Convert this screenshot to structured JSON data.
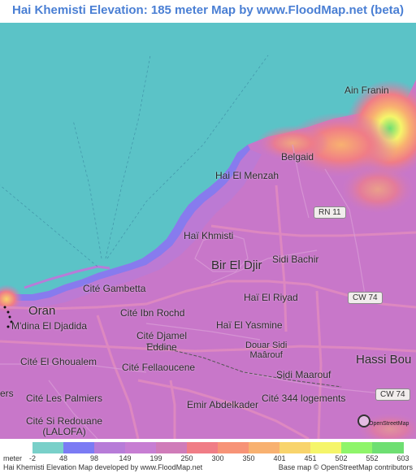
{
  "title": "Hai Khemisti Elevation: 185 meter Map by www.FloodMap.net (beta)",
  "places": [
    {
      "id": "ain-franin",
      "label": "Ain Franin"
    },
    {
      "id": "belgaid",
      "label": "Belgaid"
    },
    {
      "id": "hai-el-menzah",
      "label": "Hai El Menzah"
    },
    {
      "id": "hai-khmisti",
      "label": "Haï Khmisti"
    },
    {
      "id": "bir-el-djir",
      "label": "Bir El Djir"
    },
    {
      "id": "sidi-bachir",
      "label": "Sidi Bachir"
    },
    {
      "id": "cite-gambetta",
      "label": "Cité Gambetta"
    },
    {
      "id": "oran",
      "label": "Oran"
    },
    {
      "id": "cite-ibn-rochd",
      "label": "Cité Ibn Rochd"
    },
    {
      "id": "hai-el-riyad",
      "label": "Haï El Riyad"
    },
    {
      "id": "mdina-el-djadida",
      "label": "M'dina El Djadida"
    },
    {
      "id": "hai-el-yasmine",
      "label": "Haï El Yasmine"
    },
    {
      "id": "cite-djamel-eddine",
      "label": "Cité Djamel\nEddine"
    },
    {
      "id": "douar-sidi-maarouf",
      "label": "Douar Sidi\nMaârouf"
    },
    {
      "id": "hassi-bou",
      "label": "Hassi Bou"
    },
    {
      "id": "cite-el-ghoualem",
      "label": "Cité El Ghoualem"
    },
    {
      "id": "cite-fellaoucene",
      "label": "Cité Fellaoucene"
    },
    {
      "id": "sidi-maarouf",
      "label": "Sidi Maarouf"
    },
    {
      "id": "ers",
      "label": "ers"
    },
    {
      "id": "cite-les-palmiers",
      "label": "Cité Les Palmiers"
    },
    {
      "id": "emir-abdelkader",
      "label": "Emir Abdelkader"
    },
    {
      "id": "cite-344-logements",
      "label": "Cité 344 logements"
    },
    {
      "id": "cite-si-redouane",
      "label": "Cité Si Redouane\n(LALOFA)"
    }
  ],
  "road_shields": [
    {
      "id": "rn11",
      "label": "RN 11"
    },
    {
      "id": "cw74-a",
      "label": "CW 74"
    },
    {
      "id": "cw74-b",
      "label": "CW 74"
    }
  ],
  "attribution_badge": "OpenStreetMap",
  "legend": {
    "unit_label": "meter",
    "ticks": [
      "-2",
      "48",
      "98",
      "149",
      "199",
      "250",
      "300",
      "350",
      "401",
      "451",
      "502",
      "552",
      "603"
    ],
    "colors": [
      "#79d0c9",
      "#7b7bf4",
      "#b77cd8",
      "#c77ed3",
      "#d07cb9",
      "#f07d86",
      "#f79377",
      "#f8b170",
      "#f8d46c",
      "#f5f56a",
      "#8ff56a",
      "#6edf72"
    ]
  },
  "footer": {
    "left": "Hai Khemisti Elevation Map developed by www.FloodMap.net",
    "right": "Base map © OpenStreetMap contributors"
  },
  "colors": {
    "sea": "#5bc3c7",
    "land": "#c877c9",
    "title": "#4a7fd4"
  }
}
